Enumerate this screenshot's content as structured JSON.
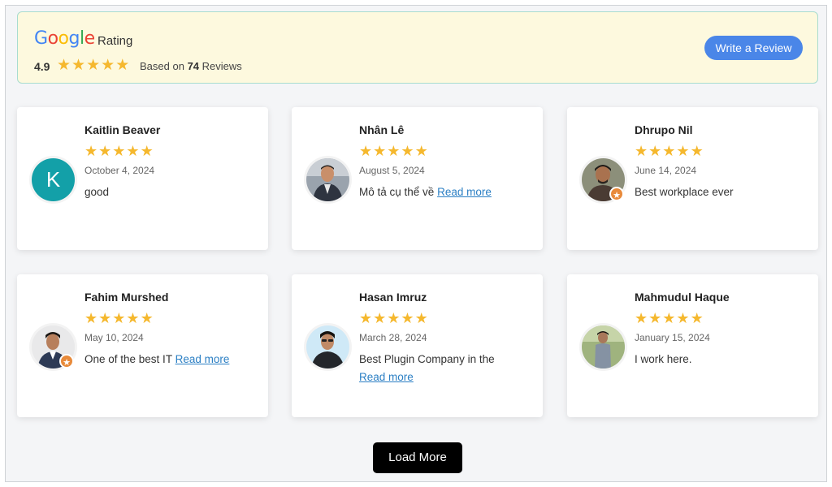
{
  "summary": {
    "brand_letters": [
      "G",
      "o",
      "o",
      "g",
      "l",
      "e"
    ],
    "brand_colors": [
      "#4285F4",
      "#EA4335",
      "#FBBC05",
      "#4285F4",
      "#34A853",
      "#EA4335"
    ],
    "rating_label": "Rating",
    "score": "4.9",
    "stars": 5,
    "based_prefix": "Based on",
    "review_count": "74",
    "reviews_word": "Reviews",
    "write_review_label": "Write a Review"
  },
  "colors": {
    "star": "#f5b82e",
    "button_blue": "#4a86e8",
    "link": "#2b7fc4",
    "banner_bg": "#fdf9de"
  },
  "reviews": [
    {
      "name": "Kaitlin Beaver",
      "stars": 5,
      "date": "October 4, 2024",
      "text": "good",
      "read_more": "",
      "avatar_type": "letter",
      "avatar_letter": "K",
      "badge": false
    },
    {
      "name": "Nhân Lê",
      "stars": 5,
      "date": "August 5, 2024",
      "text": "Mô tả cụ thể về",
      "read_more": "Read more",
      "avatar_type": "photo",
      "badge": false
    },
    {
      "name": "Dhrupo Nil",
      "stars": 5,
      "date": "June 14, 2024",
      "text": "Best workplace ever",
      "read_more": "",
      "avatar_type": "photo",
      "badge": true
    },
    {
      "name": "Fahim Murshed",
      "stars": 5,
      "date": "May 10, 2024",
      "text": "One of the best IT",
      "read_more": "Read more",
      "avatar_type": "photo",
      "badge": true
    },
    {
      "name": "Hasan Imruz",
      "stars": 5,
      "date": "March 28, 2024",
      "text": "Best Plugin Company in the",
      "read_more": "Read more",
      "avatar_type": "photo",
      "badge": false
    },
    {
      "name": "Mahmudul Haque",
      "stars": 5,
      "date": "January 15, 2024",
      "text": "I work here.",
      "read_more": "",
      "avatar_type": "photo",
      "badge": false
    }
  ],
  "load_more_label": "Load More"
}
